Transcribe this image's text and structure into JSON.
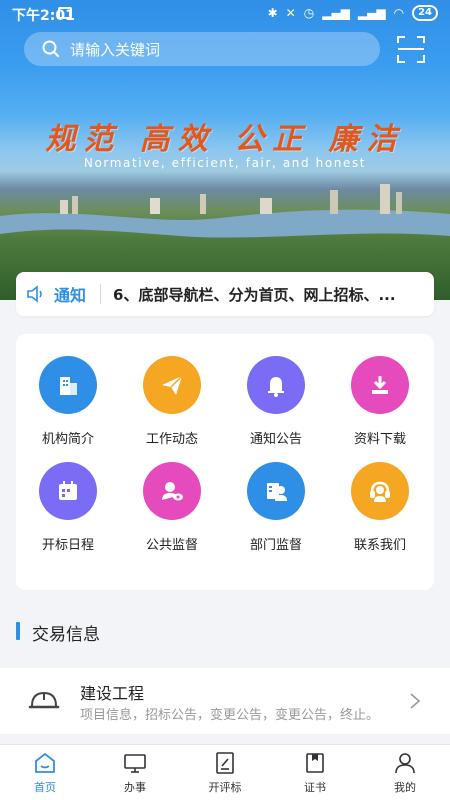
{
  "status": {
    "time": "下午2:01",
    "battery": "24"
  },
  "search": {
    "placeholder": "请输入关键词"
  },
  "banner": {
    "slogan": "规范 高效 公正 廉洁",
    "slogan_en": "Normative, efficient, fair, and honest"
  },
  "notice": {
    "label": "通知",
    "text": "6、底部导航栏、分为首页、网上招标、..."
  },
  "grid": [
    {
      "label": "机构简介",
      "icon": "building-icon",
      "color": "#2f8fe6"
    },
    {
      "label": "工作动态",
      "icon": "paper-plane-icon",
      "color": "#f5a623"
    },
    {
      "label": "通知公告",
      "icon": "bell-icon",
      "color": "#7b6cf6"
    },
    {
      "label": "资料下载",
      "icon": "download-icon",
      "color": "#e64bbd"
    },
    {
      "label": "开标日程",
      "icon": "calendar-icon",
      "color": "#7b6cf6"
    },
    {
      "label": "公共监督",
      "icon": "person-eye-icon",
      "color": "#e64bbd"
    },
    {
      "label": "部门监督",
      "icon": "id-card-icon",
      "color": "#2f8fe6"
    },
    {
      "label": "联系我们",
      "icon": "headset-icon",
      "color": "#f5a623"
    }
  ],
  "section": {
    "title": "交易信息"
  },
  "card": {
    "title": "建设工程",
    "subtitle": "项目信息，招标公告，变更公告，变更公告，终止。",
    "icon": "hard-hat-icon"
  },
  "tabs": [
    {
      "label": "首页",
      "icon": "home-icon",
      "active": true
    },
    {
      "label": "办事",
      "icon": "monitor-icon",
      "active": false
    },
    {
      "label": "开评标",
      "icon": "edit-doc-icon",
      "active": false
    },
    {
      "label": "证书",
      "icon": "certificate-icon",
      "active": false
    },
    {
      "label": "我的",
      "icon": "user-icon",
      "active": false
    }
  ],
  "colors": {
    "accent": "#2f8fe6"
  }
}
